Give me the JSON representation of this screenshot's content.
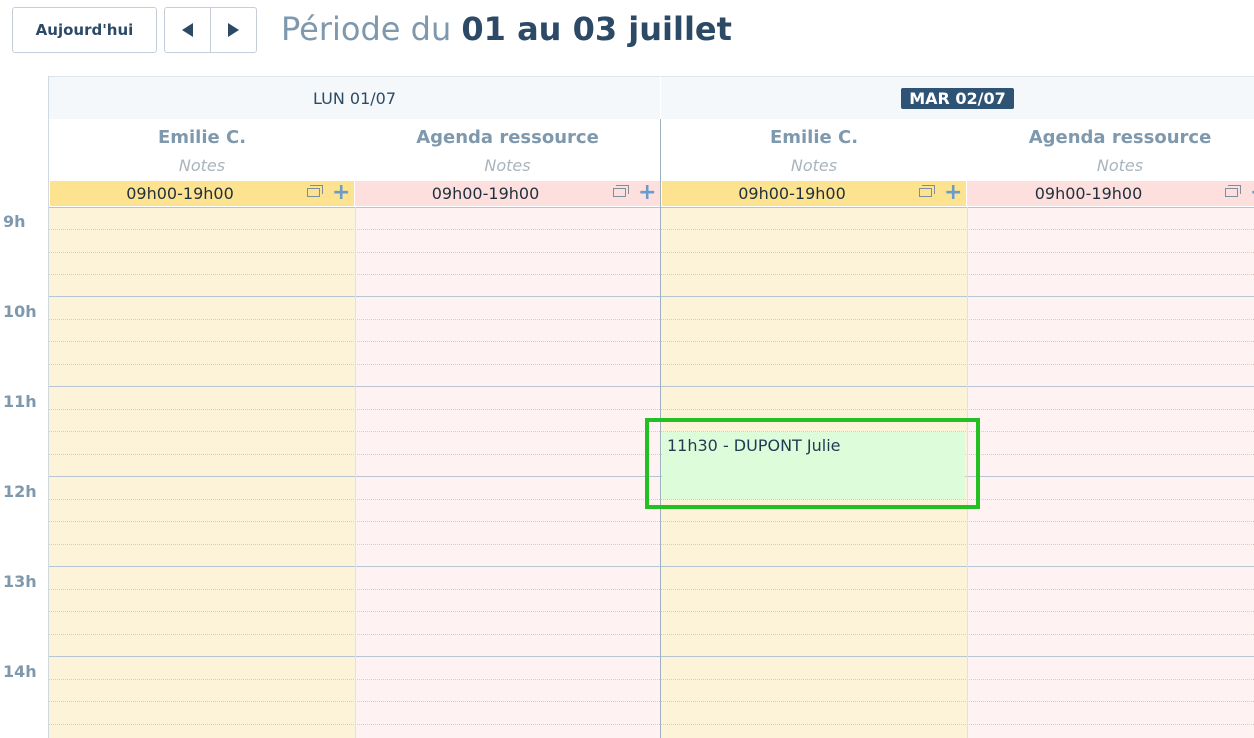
{
  "toolbar": {
    "today_label": "Aujourd'hui",
    "period_prefix": "Période du",
    "period_dates": "01 au 03 juillet"
  },
  "days": [
    {
      "label": "LUN 01/07",
      "is_today": false
    },
    {
      "label": "MAR 02/07",
      "is_today": true
    }
  ],
  "resources": [
    {
      "name": "Emilie C.",
      "notes": "Notes",
      "hours": "09h00-19h00",
      "color": "#fde28f"
    },
    {
      "name": "Agenda ressource",
      "notes": "Notes",
      "hours": "09h00-19h00",
      "color": "#fde0de"
    },
    {
      "name": "Emilie C.",
      "notes": "Notes",
      "hours": "09h00-19h00",
      "color": "#fde28f"
    },
    {
      "name": "Agenda ressource",
      "notes": "Notes",
      "hours": "09h00-19h00",
      "color": "#fde0de"
    }
  ],
  "time_labels": [
    "9h",
    "10h",
    "11h",
    "12h",
    "13h",
    "14h"
  ],
  "event": {
    "label": "11h30 - DUPONT Julie",
    "day": "MAR 02/07",
    "resource": "Emilie C.",
    "color": "#dcfcda",
    "highlight_color": "#22c022"
  },
  "colors": {
    "accent": "#2e5374",
    "text": "#2c4a66",
    "muted": "#7e98ad",
    "plus": "#6a9ccb"
  }
}
